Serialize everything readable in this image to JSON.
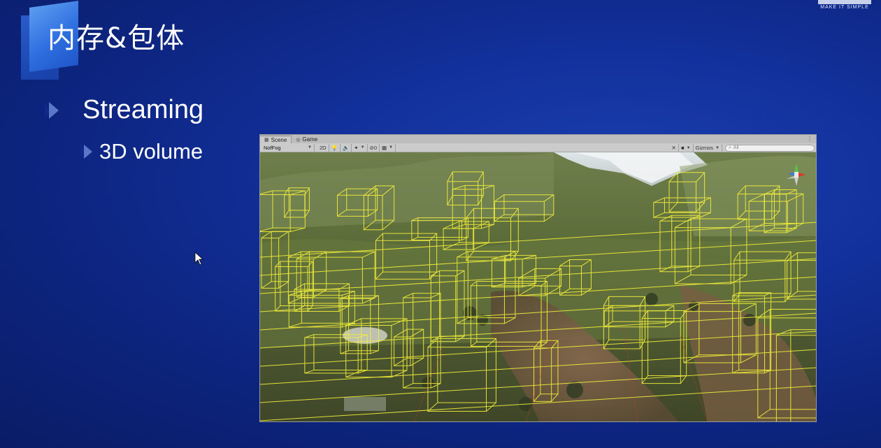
{
  "slide": {
    "title": "内存&包体",
    "bullet_1": "Streaming",
    "bullet_2": "3D volume"
  },
  "logo": {
    "tagline": "MAKE IT SIMPLE"
  },
  "editor": {
    "tabs": [
      {
        "label": "Scene",
        "icon": "scene-icon",
        "active": true
      },
      {
        "label": "Game",
        "icon": "game-icon",
        "active": false
      }
    ],
    "toolbar": {
      "shading_mode": "NofFog",
      "mode_2d": "2D",
      "hidden_count": "0",
      "gizmos_label": "Gizmos",
      "search_placeholder": "All"
    }
  },
  "colors": {
    "slide_background": "#12309a",
    "accent_blue": "#2f6fe0",
    "volume_outline": "#f4f03a",
    "editor_chrome": "#c8c8c8"
  }
}
